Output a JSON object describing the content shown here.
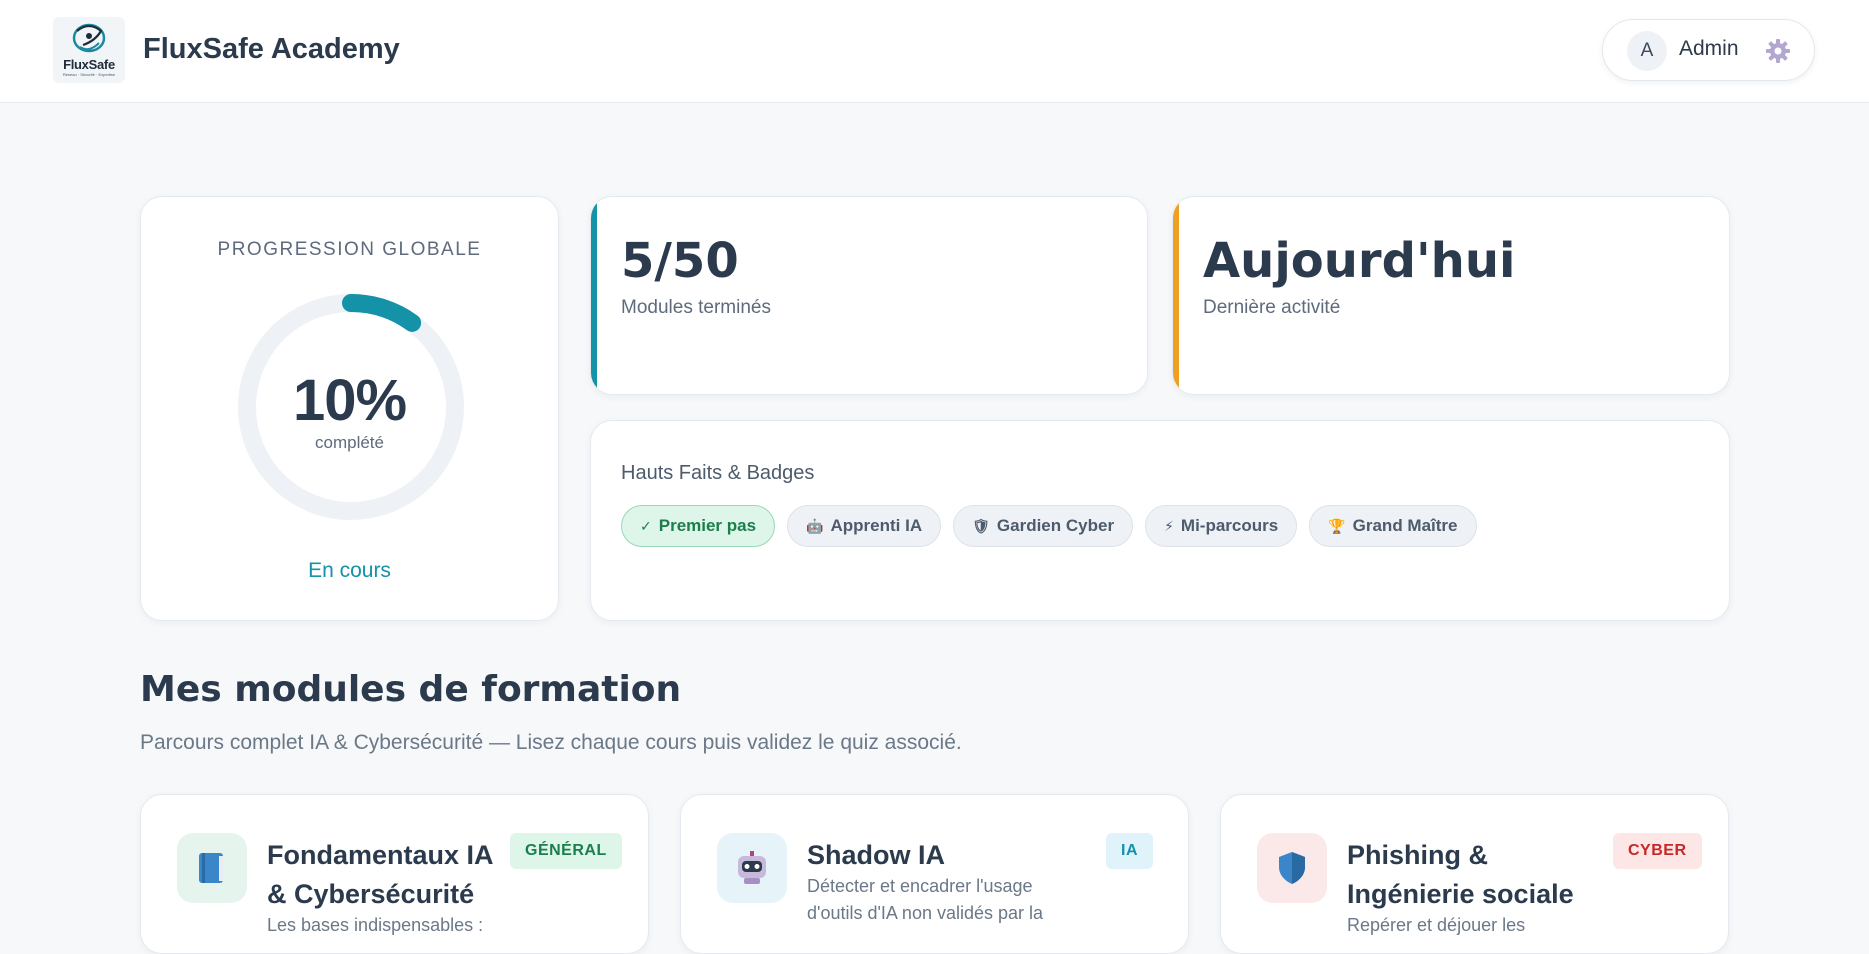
{
  "header": {
    "logo_word": "FluxSafe",
    "logo_tagline": "Réseau · Sécurité · Expertise",
    "brand": "FluxSafe Academy",
    "user_initial": "A",
    "user_name": "Admin",
    "settings_icon": "gear-icon"
  },
  "progress": {
    "title": "PROGRESSION GLOBALE",
    "percent_label": "10%",
    "percent_value": 0.1,
    "sub": "complété",
    "status": "En cours",
    "ring_color": "#1392a8",
    "track_color": "#eef2f6"
  },
  "stats": [
    {
      "value": "5/50",
      "label": "Modules terminés",
      "accent": "#1392a8"
    },
    {
      "value": "Aujourd'hui",
      "label": "Dernière activité",
      "accent": "#f0a020"
    }
  ],
  "badges": {
    "title": "Hauts Faits & Badges",
    "items": [
      {
        "icon": "✓",
        "icon_name": "check-icon",
        "label": "Premier pas",
        "earned": true
      },
      {
        "icon": "🤖",
        "icon_name": "robot-icon",
        "label": "Apprenti IA",
        "earned": false
      },
      {
        "icon": "🛡",
        "icon_name": "shield-icon",
        "label": "Gardien Cyber",
        "earned": false
      },
      {
        "icon": "⚡",
        "icon_name": "lightning-icon",
        "label": "Mi-parcours",
        "earned": false
      },
      {
        "icon": "🏆",
        "icon_name": "trophy-icon",
        "label": "Grand Maître",
        "earned": false
      }
    ]
  },
  "modules_section": {
    "title": "Mes modules de formation",
    "subtitle": "Parcours complet IA & Cybersécurité — Lisez chaque cours puis validez le quiz associé."
  },
  "modules": [
    {
      "title": "Fondamentaux IA & Cybersécurité",
      "tag": "GÉNÉRAL",
      "desc": "Les bases indispensables :",
      "icon_name": "book-icon",
      "tag_bg": "#def5ea",
      "tag_color": "#1a7f4b",
      "icon_bg": "#e6f4ee"
    },
    {
      "title": "Shadow IA",
      "tag": "IA",
      "desc": "Détecter et encadrer l'usage d'outils d'IA non validés par la",
      "icon_name": "robot-icon",
      "tag_bg": "#e0f3fb",
      "tag_color": "#1392a8",
      "icon_bg": "#e6f4fa"
    },
    {
      "title": "Phishing & Ingénierie sociale",
      "tag": "CYBER",
      "desc": "Repérer et déjouer les",
      "icon_name": "shield-icon",
      "tag_bg": "#fde6e6",
      "tag_color": "#c62828",
      "icon_bg": "#fbe8e8"
    }
  ]
}
